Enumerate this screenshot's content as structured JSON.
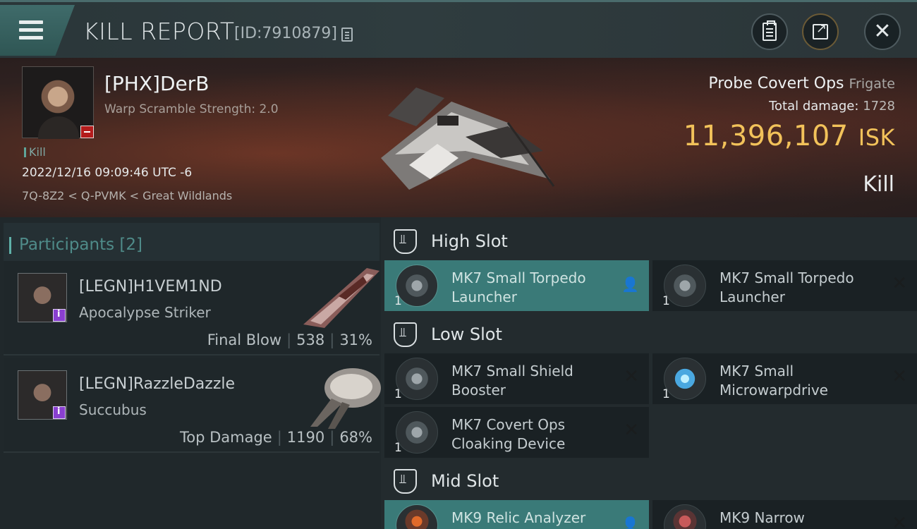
{
  "header": {
    "title": "KILL REPORT",
    "report_id": "[ID:7910879]",
    "menu_icon": "hamburger-icon",
    "buttons": [
      {
        "name": "clipboard-button",
        "icon": "clipboard-icon"
      },
      {
        "name": "share-button",
        "icon": "share-icon"
      },
      {
        "name": "close-button",
        "icon": "close-icon"
      }
    ]
  },
  "victim": {
    "pilot": "[PHX]DerB",
    "scramble": "Warp Scramble Strength: 2.0",
    "tag": "Kill",
    "datetime": "2022/12/16 09:09:46 UTC -6",
    "location": "7Q-8Z2 < Q-PVMK < Great Wildlands",
    "ship": "Probe Covert Ops",
    "ship_class": "Frigate",
    "total_damage_label": "Total damage:",
    "total_damage": "1728",
    "isk_value": "11,396,107",
    "isk_unit": "ISK",
    "result": "Kill"
  },
  "participants": {
    "label": "Participants",
    "count": "[2]",
    "items": [
      {
        "name": "[LEGN]H1VEM1ND",
        "ship": "Apocalypse Striker",
        "stat_label": "Final Blow",
        "damage": "538",
        "percent": "31%"
      },
      {
        "name": "[LEGN]RazzleDazzle",
        "ship": "Succubus",
        "stat_label": "Top Damage",
        "damage": "1190",
        "percent": "68%"
      }
    ]
  },
  "slots": {
    "high": {
      "title": "High Slot",
      "modules": [
        {
          "line1": "MK7 Small Torpedo",
          "line2": "Launcher",
          "qty": "1",
          "state": "highlighted"
        },
        {
          "line1": "MK7 Small Torpedo",
          "line2": "Launcher",
          "qty": "1",
          "state": "destroyed"
        }
      ]
    },
    "low": {
      "title": "Low Slot",
      "modules": [
        {
          "line1": "MK7 Small Shield",
          "line2": "Booster",
          "qty": "1",
          "state": "destroyed"
        },
        {
          "line1": "MK7 Small",
          "line2": "Microwarpdrive",
          "qty": "1",
          "state": "destroyed"
        },
        {
          "line1": "MK7 Covert Ops",
          "line2": "Cloaking Device",
          "qty": "1",
          "state": "destroyed"
        }
      ]
    },
    "mid": {
      "title": "Mid Slot",
      "modules": [
        {
          "line1": "MK9 Relic Analyzer",
          "line2": "",
          "qty": "",
          "state": "highlighted"
        },
        {
          "line1": "MK9 Narrow",
          "line2": "",
          "qty": "",
          "state": "destroyed"
        }
      ]
    }
  },
  "colors": {
    "accent_teal": "#3a7a78",
    "isk_gold": "#f2c25a",
    "badge_red": "#b41c1c",
    "badge_purple": "#8a3fd0"
  }
}
